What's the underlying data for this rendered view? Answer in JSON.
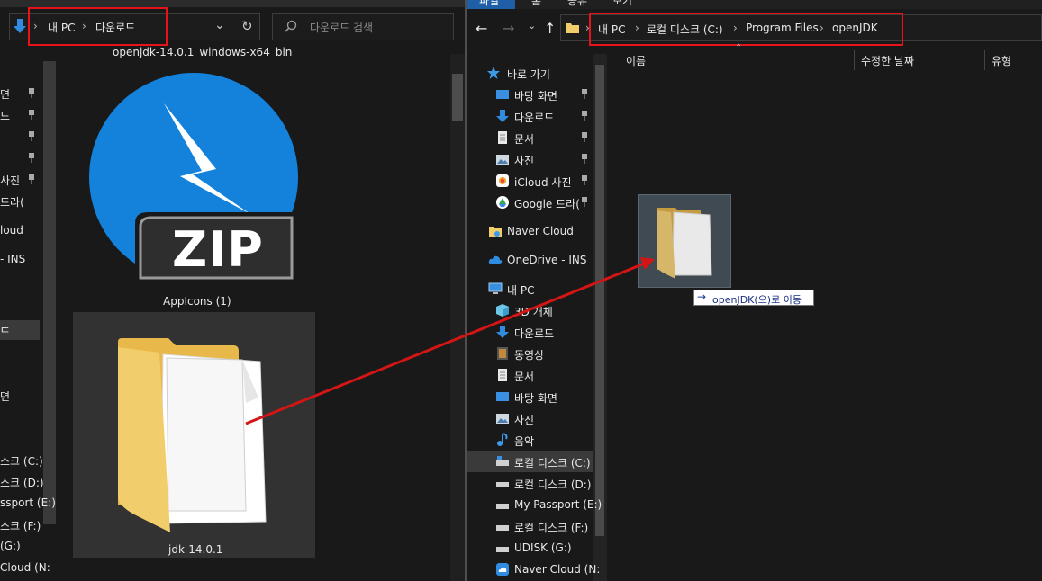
{
  "left_window": {
    "address": {
      "pc": "내 PC",
      "folder": "다운로드"
    },
    "search_placeholder": "다운로드 검색",
    "file_top_label": "openjdk-14.0.1_windows-x64_bin",
    "zip_text": "ZIP",
    "appicons_label": "AppIcons (1)",
    "folder_label": "jdk-14.0.1",
    "nav_fragments": [
      "면",
      "드",
      "사진",
      "드라(",
      "loud",
      "- INS",
      "드",
      "면",
      "스크 (C:)",
      "스크 (D:)",
      "ssport (E:)",
      "스크 (F:)",
      "(G:)",
      "Cloud (N:"
    ]
  },
  "right_window": {
    "tabs": [
      "파일",
      "홈",
      "공유",
      "보기"
    ],
    "address": {
      "pc": "내 PC",
      "disk": "로컬 디스크 (C:)",
      "program_files": "Program Files",
      "folder": "openJDK"
    },
    "columns": {
      "name": "이름",
      "date": "수정한 날짜",
      "type": "유형"
    },
    "sidebar": {
      "quick_access": "바로 가기",
      "quick_items": [
        "바탕 화면",
        "다운로드",
        "문서",
        "사진",
        "iCloud 사진",
        "Google 드라("
      ],
      "naver_cloud": "Naver Cloud",
      "onedrive": "OneDrive - INS",
      "this_pc": "내 PC",
      "pc_items": [
        "3D 개체",
        "다운로드",
        "동영상",
        "문서",
        "바탕 화면",
        "사진",
        "음악",
        "로컬 디스크 (C:)",
        "로컬 디스크 (D:)",
        "My Passport (E:)",
        "로컬 디스크 (F:)",
        "UDISK (G:)",
        "Naver Cloud (N:"
      ]
    },
    "drag_tooltip": "openJDK(으)로 이동"
  },
  "colors": {
    "highlight_box": "#e8121b",
    "arrow": "#d41515",
    "folder": "#f2cd6b",
    "zip_blue": "#1482db"
  }
}
